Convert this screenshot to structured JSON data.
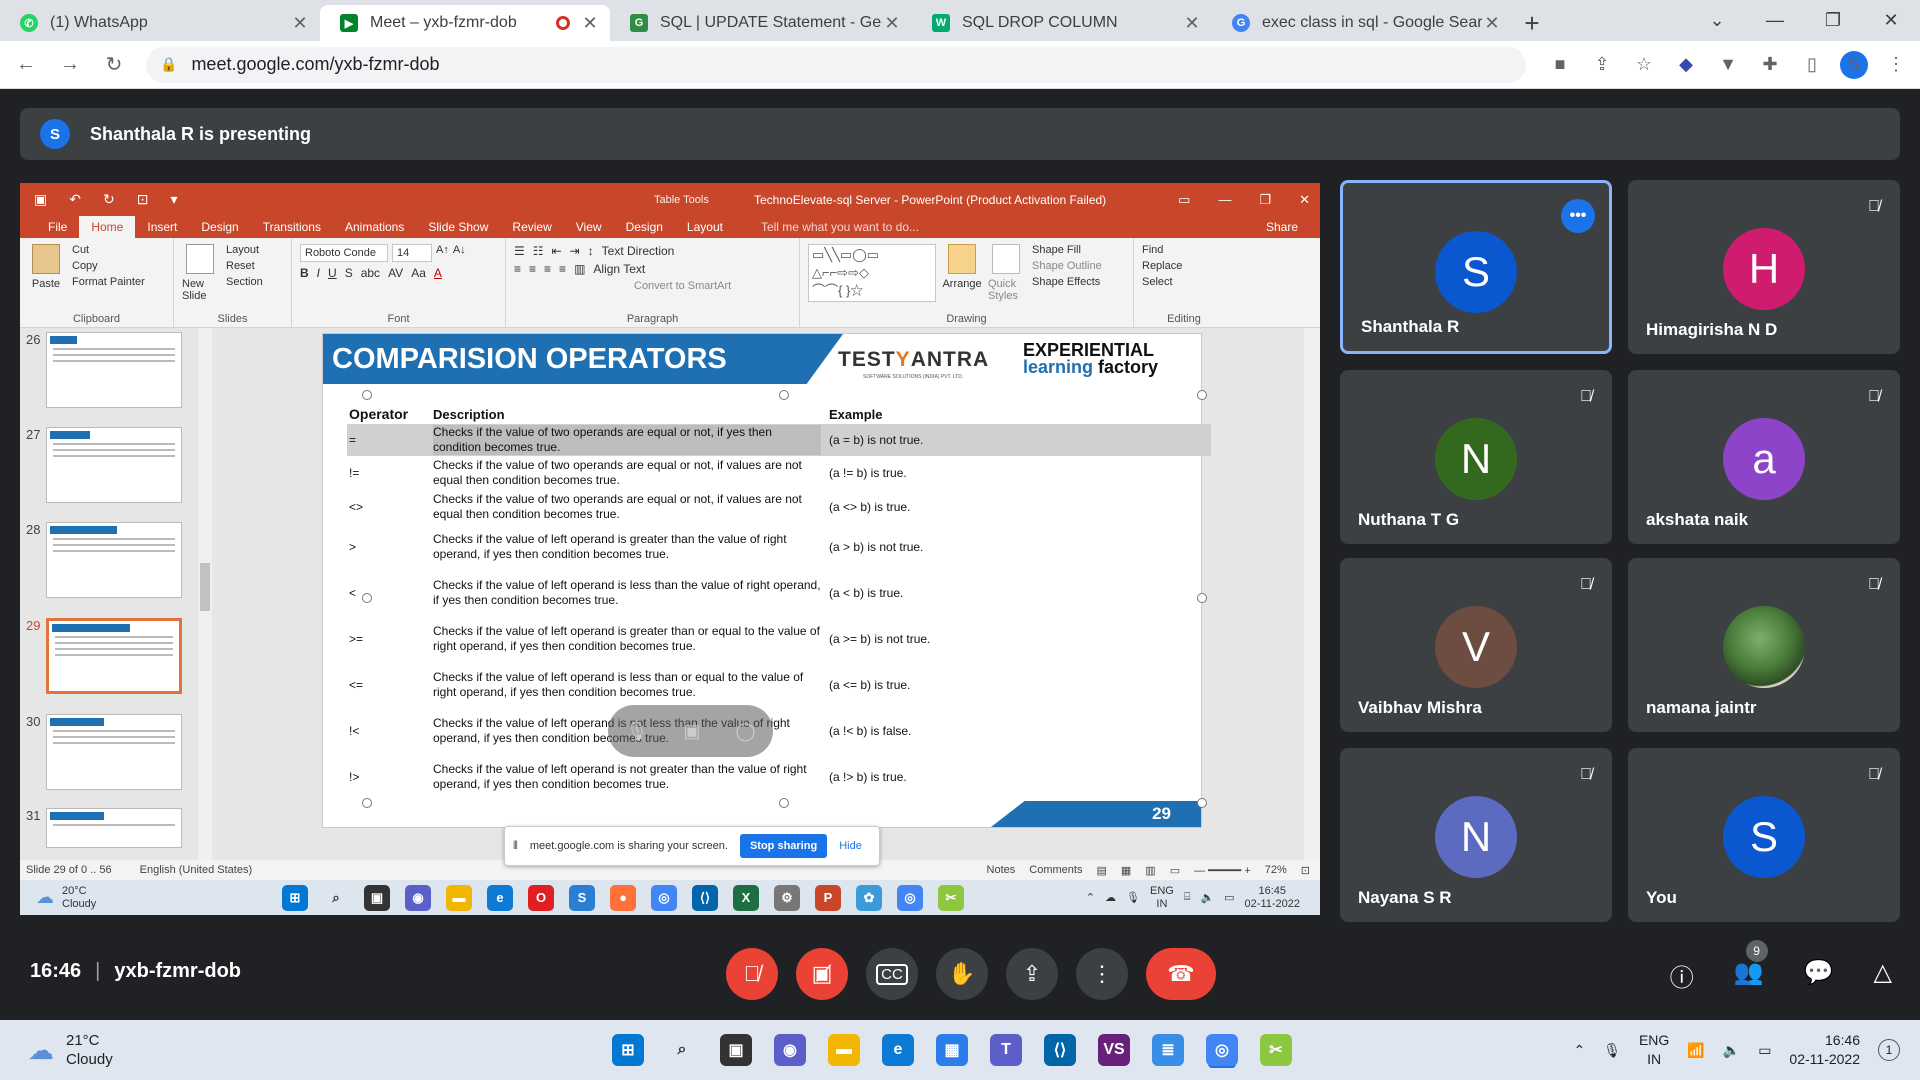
{
  "browser": {
    "tabs": [
      {
        "label": "(1) WhatsApp",
        "icon": "whatsapp-icon",
        "color": "#25d366"
      },
      {
        "label": "Meet – yxb-fzmr-dob",
        "icon": "meet-icon",
        "color": "#00832d"
      },
      {
        "label": "SQL | UPDATE Statement - Geeks",
        "icon": "geeks-icon",
        "color": "#2f8d46"
      },
      {
        "label": "SQL DROP COLUMN",
        "icon": "w3schools-icon",
        "color": "#04aa6d"
      },
      {
        "label": "exec class in sql - Google Search",
        "icon": "google-icon",
        "color": "#4285f4"
      }
    ],
    "url": "meet.google.com/yxb-fzmr-dob",
    "profile_initial": "S"
  },
  "meet": {
    "presenting_initial": "S",
    "presenting_text": "Shanthala R is presenting",
    "time": "16:46",
    "meeting_code": "yxb-fzmr-dob",
    "participant_count": "9",
    "participants": [
      {
        "name": "Shanthala R",
        "initial": "S",
        "color": "#0b57d0",
        "speaking": true
      },
      {
        "name": "Himagirisha N D",
        "initial": "H",
        "color": "#d01c6f",
        "muted": true
      },
      {
        "name": "Nuthana T G",
        "initial": "N",
        "color": "#33691e",
        "muted": true
      },
      {
        "name": "akshata naik",
        "initial": "a",
        "color": "#8e44c9",
        "muted": true
      },
      {
        "name": "Vaibhav Mishra",
        "initial": "V",
        "color": "#6d4c41",
        "muted": true
      },
      {
        "name": "namana jaintr",
        "initial": "",
        "color": "#4a7c3a",
        "muted": true
      },
      {
        "name": "Nayana S R",
        "initial": "N",
        "color": "#5c6bc0",
        "muted": true
      },
      {
        "name": "You",
        "initial": "S",
        "color": "#0b57d0",
        "muted": true
      }
    ]
  },
  "powerpoint": {
    "table_tools": "Table Tools",
    "doc_title": "TechnoElevate-sql Server - PowerPoint (Product Activation Failed)",
    "tabs": [
      "File",
      "Home",
      "Insert",
      "Design",
      "Transitions",
      "Animations",
      "Slide Show",
      "Review",
      "View",
      "Design",
      "Layout"
    ],
    "tell_me": "Tell me what you want to do...",
    "share": "Share",
    "ribbon": {
      "clipboard": {
        "label": "Clipboard",
        "paste": "Paste",
        "cut": "Cut",
        "copy": "Copy",
        "format_painter": "Format Painter"
      },
      "slides": {
        "label": "Slides",
        "new_slide": "New Slide",
        "layout": "Layout",
        "reset": "Reset",
        "section": "Section"
      },
      "font": {
        "label": "Font",
        "name": "Roboto Conde",
        "size": "14"
      },
      "paragraph": {
        "label": "Paragraph",
        "text_direction": "Text Direction",
        "align_text": "Align Text",
        "smartart": "Convert to SmartArt"
      },
      "drawing": {
        "label": "Drawing",
        "arrange": "Arrange",
        "quick_styles": "Quick Styles",
        "shape_fill": "Shape Fill",
        "shape_outline": "Shape Outline",
        "shape_effects": "Shape Effects"
      },
      "editing": {
        "label": "Editing",
        "find": "Find",
        "replace": "Replace",
        "select": "Select"
      }
    },
    "thumbnails": [
      "26",
      "27",
      "28",
      "29",
      "30",
      "31"
    ],
    "selected_slide": "29",
    "slide": {
      "title": "COMPARISION OPERATORS",
      "logo1_a": "TEST",
      "logo1_b": "Y",
      "logo1_c": "ANTRA",
      "logo1_sub": "SOFTWARE SOLUTIONS (INDIA) PVT. LTD.",
      "logo2_line1": "EXPERIENTIAL",
      "logo2_line2a": "learning",
      "logo2_line2b": " factory",
      "headers": [
        "Operator",
        "Description",
        "Example"
      ],
      "rows": [
        {
          "op": "=",
          "desc": "Checks if the value of two operands are equal or not, if yes then condition becomes true.",
          "ex": "(a = b) is not true."
        },
        {
          "op": "!=",
          "desc": "Checks if the value of two operands are equal or not, if values are not equal then condition becomes true.",
          "ex": "(a != b) is true."
        },
        {
          "op": "<>",
          "desc": "Checks if the value of two operands are equal or not, if values are not equal then condition becomes true.",
          "ex": "(a <> b) is true."
        },
        {
          "op": ">",
          "desc": "Checks if the value of left operand is greater than the value of right operand, if yes then condition becomes true.",
          "ex": "(a > b) is not true."
        },
        {
          "op": "<",
          "desc": "Checks if the value of left operand is less than the value of right operand, if yes then condition becomes true.",
          "ex": "(a < b) is true."
        },
        {
          "op": ">=",
          "desc": "Checks if the value of left operand is greater than or equal to the value of right operand, if yes then condition becomes true.",
          "ex": "(a >= b) is not true."
        },
        {
          "op": "<=",
          "desc": "Checks if the value of left operand is less than or equal to the value of right operand, if yes then condition becomes true.",
          "ex": "(a <= b) is true."
        },
        {
          "op": "!<",
          "desc": "Checks if the value of left operand is not less than the value of right operand, if yes then condition becomes true.",
          "ex": "(a !< b) is false."
        },
        {
          "op": "!>",
          "desc": "Checks if the value of left operand is not greater than the value of right operand, if yes then condition becomes true.",
          "ex": "(a !> b) is true."
        }
      ],
      "page_number": "29"
    },
    "status": {
      "slide_info": "Slide 29 of 0 .. 56",
      "language": "English (United States)",
      "notes": "Notes",
      "comments": "Comments",
      "zoom": "72%"
    },
    "share_notice": {
      "text": "meet.google.com is sharing your screen.",
      "stop": "Stop sharing",
      "hide": "Hide"
    },
    "inner_taskbar": {
      "temp": "20°C",
      "weather": "Cloudy",
      "lang1": "ENG",
      "lang2": "IN",
      "time": "16:45",
      "date": "02-11-2022"
    }
  },
  "taskbar": {
    "temp": "21°C",
    "weather": "Cloudy",
    "lang1": "ENG",
    "lang2": "IN",
    "time": "16:46",
    "date": "02-11-2022",
    "notif": "1"
  }
}
